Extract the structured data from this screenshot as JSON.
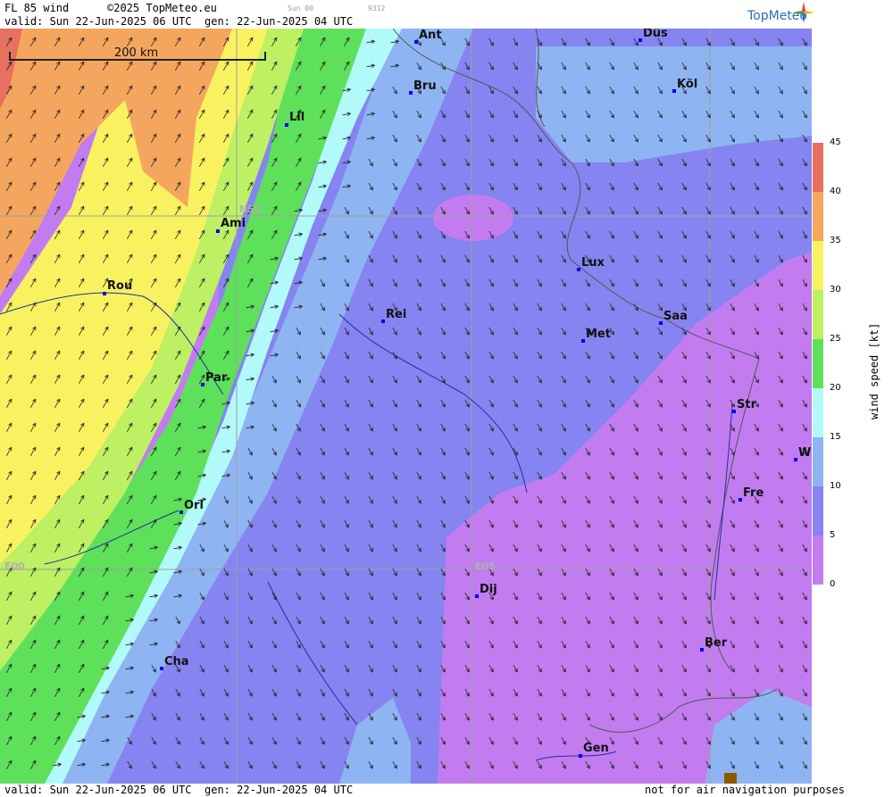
{
  "header": {
    "product": "FL 85 wind",
    "copyright": "©2025 TopMeteo.eu",
    "valid": "valid:  Sun  22-Jun-2025  06 UTC",
    "generated": "gen: 22-Jun-2025 04 UTC",
    "small_code_1": "Sun 00",
    "small_code_2": "9312",
    "logo": "TopMeteo"
  },
  "footer": {
    "valid": "valid:  Sun  22-Jun-2025  06 UTC",
    "generated": "gen: 22-Jun-2025 04 UTC",
    "disclaimer": "not for air navigation purposes"
  },
  "map": {
    "scale_label": "200 km",
    "grid_labels": {
      "lat": "N50",
      "lon0": "E00",
      "lon5": "E05"
    },
    "cities": [
      {
        "name": "Ant"
      },
      {
        "name": "Düs"
      },
      {
        "name": "Bru"
      },
      {
        "name": "Köl"
      },
      {
        "name": "Lil"
      },
      {
        "name": "Ami"
      },
      {
        "name": "Rou"
      },
      {
        "name": "Lux"
      },
      {
        "name": "Rei"
      },
      {
        "name": "Met"
      },
      {
        "name": "Saa"
      },
      {
        "name": "Par"
      },
      {
        "name": "Str"
      },
      {
        "name": "W"
      },
      {
        "name": "Fre"
      },
      {
        "name": "Orl"
      },
      {
        "name": "Dij"
      },
      {
        "name": "Ber"
      },
      {
        "name": "Cha"
      },
      {
        "name": "Gen"
      }
    ]
  },
  "legend": {
    "title": "wind speed [kt]",
    "ticks": [
      "45",
      "40",
      "35",
      "30",
      "25",
      "20",
      "15",
      "10",
      "5",
      "0"
    ],
    "colors": [
      "#e8705f",
      "#f4a65e",
      "#f9f260",
      "#bdf063",
      "#5ee05b",
      "#b2fafa",
      "#8fb4f2",
      "#8584f0",
      "#c27cf0"
    ]
  }
}
